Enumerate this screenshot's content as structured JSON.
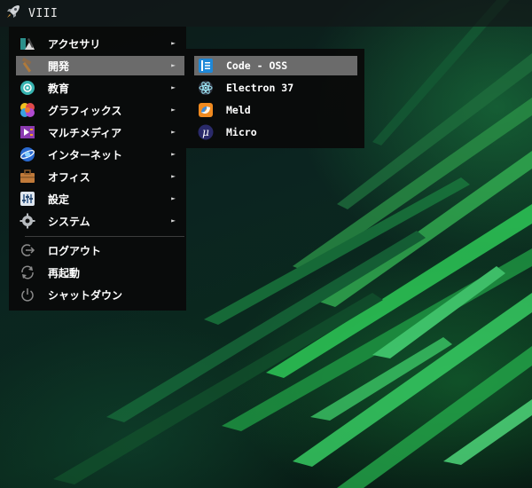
{
  "topbar": {
    "title": "VIII",
    "icon": "rocket-icon"
  },
  "menu": {
    "categories": [
      {
        "label": "アクセサリ",
        "icon": "accessories-icon",
        "has_submenu": true
      },
      {
        "label": "開発",
        "icon": "development-icon",
        "has_submenu": true,
        "selected": true
      },
      {
        "label": "教育",
        "icon": "education-icon",
        "has_submenu": true
      },
      {
        "label": "グラフィックス",
        "icon": "graphics-icon",
        "has_submenu": true
      },
      {
        "label": "マルチメディア",
        "icon": "multimedia-icon",
        "has_submenu": true
      },
      {
        "label": "インターネット",
        "icon": "internet-icon",
        "has_submenu": true
      },
      {
        "label": "オフィス",
        "icon": "office-icon",
        "has_submenu": true
      },
      {
        "label": "設定",
        "icon": "settings-icon",
        "has_submenu": true
      },
      {
        "label": "システム",
        "icon": "system-icon",
        "has_submenu": true
      }
    ],
    "actions": [
      {
        "label": "ログアウト",
        "icon": "logout-icon"
      },
      {
        "label": "再起動",
        "icon": "restart-icon"
      },
      {
        "label": "シャットダウン",
        "icon": "shutdown-icon"
      }
    ],
    "arrow": "►"
  },
  "submenu": {
    "items": [
      {
        "label": "Code - OSS",
        "icon": "code-oss-icon",
        "selected": true
      },
      {
        "label": "Electron 37",
        "icon": "electron-icon"
      },
      {
        "label": "Meld",
        "icon": "meld-icon"
      },
      {
        "label": "Micro",
        "icon": "micro-icon",
        "glyph": "μ"
      }
    ]
  },
  "colors": {
    "menu_bg": "#0a0a0a",
    "highlight": "#6b6b6b",
    "text": "#ffffff",
    "wallpaper_accent": "#2fd15a"
  }
}
